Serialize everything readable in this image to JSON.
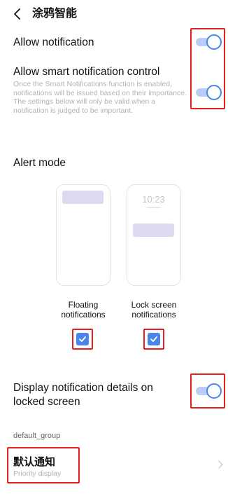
{
  "header": {
    "title": "涂鸦智能"
  },
  "settings": {
    "allow_notification": {
      "label": "Allow notification",
      "enabled": true
    },
    "smart_control": {
      "label": "Allow smart notification control",
      "description": "Once the Smart Notifications function is enabled, notifications will be issued based on their importance. The settings below will only be valid when a notification is judged to be important.",
      "enabled": true
    },
    "alert_mode": {
      "label": "Alert mode",
      "lock_time": "10:23",
      "floating": {
        "label_line1": "Floating",
        "label_line2": "notifications",
        "checked": true
      },
      "lock_screen": {
        "label_line1": "Lock screen",
        "label_line2": "notifications",
        "checked": true
      }
    },
    "details_locked": {
      "label_line1": "Display notification details on",
      "label_line2": "locked screen",
      "enabled": true
    }
  },
  "group": {
    "header": "default_group",
    "item": {
      "title": "默认通知",
      "subtitle": "Priority display"
    }
  },
  "colors": {
    "accent": "#4a86ea",
    "track": "#b9cdf6",
    "highlight": "#e52020",
    "bar": "#dcdaf2"
  }
}
